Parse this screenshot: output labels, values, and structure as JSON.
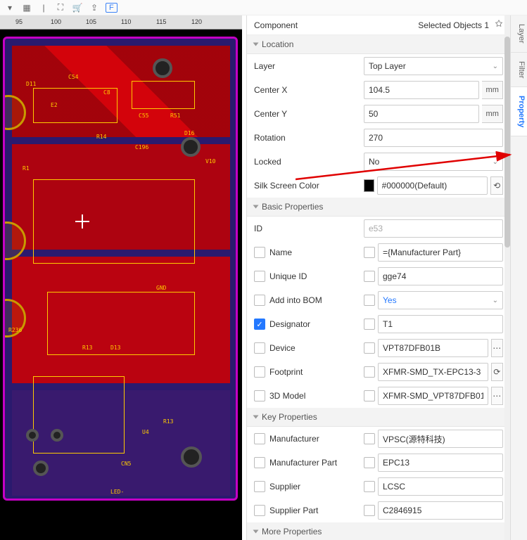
{
  "topbar": {
    "f_badge": "F"
  },
  "ruler_marks": [
    "95",
    "100",
    "105",
    "110",
    "115",
    "120"
  ],
  "canvas": {
    "labels": [
      "D11",
      "C54",
      "C8",
      "E2",
      "C55",
      "R51",
      "R14",
      "D16",
      "C196",
      "V10",
      "R1",
      "R13",
      "D13",
      "R236",
      "R13",
      "U4",
      "CN5",
      "LED-",
      "GND"
    ]
  },
  "panel": {
    "title": "Component",
    "selection": "Selected Objects 1"
  },
  "sections": {
    "location": {
      "title": "Location",
      "layer_label": "Layer",
      "layer_value": "Top Layer",
      "center_x_label": "Center X",
      "center_x_value": "104.5",
      "center_y_label": "Center Y",
      "center_y_value": "50",
      "unit": "mm",
      "rotation_label": "Rotation",
      "rotation_value": "270",
      "locked_label": "Locked",
      "locked_value": "No",
      "silk_label": "Silk Screen Color",
      "silk_value": "#000000(Default)"
    },
    "basic": {
      "title": "Basic Properties",
      "id_label": "ID",
      "id_value": "e53",
      "name_label": "Name",
      "name_value": "={Manufacturer Part}",
      "uid_label": "Unique ID",
      "uid_value": "gge74",
      "bom_label": "Add into BOM",
      "bom_value": "Yes",
      "designator_label": "Designator",
      "designator_value": "T1",
      "device_label": "Device",
      "device_value": "VPT87DFB01B",
      "footprint_label": "Footprint",
      "footprint_value": "XFMR-SMD_TX-EPC13-3",
      "model_label": "3D Model",
      "model_value": "XFMR-SMD_VPT87DFB01…"
    },
    "key": {
      "title": "Key Properties",
      "mfr_label": "Manufacturer",
      "mfr_value": "VPSC(源特科技)",
      "mpart_label": "Manufacturer Part",
      "mpart_value": "EPC13",
      "supplier_label": "Supplier",
      "supplier_value": "LCSC",
      "spart_label": "Supplier Part",
      "spart_value": "C2846915"
    },
    "more": {
      "title": "More Properties"
    }
  },
  "side_tabs": {
    "layer": "Layer",
    "filter": "Filter",
    "property": "Property"
  }
}
